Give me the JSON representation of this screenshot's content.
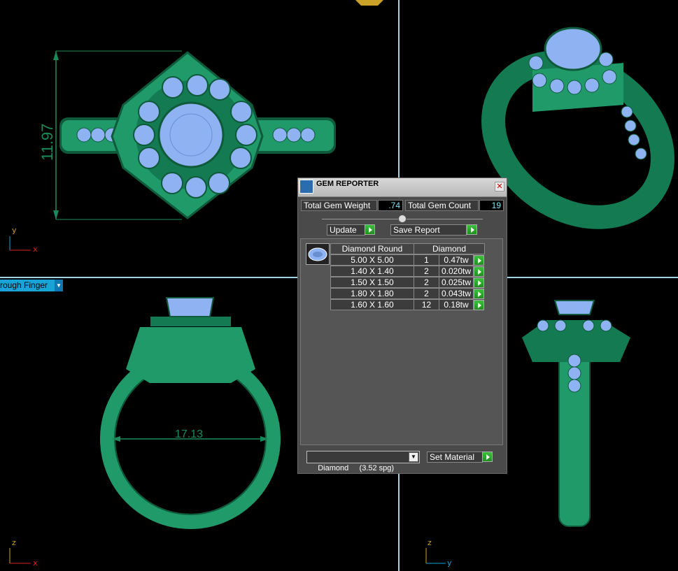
{
  "viewports": {
    "top_left": {
      "dimension": "11.97",
      "axis_v": "y",
      "axis_h": "x"
    },
    "top_right": {},
    "bottom_left": {
      "dimension": "17.13",
      "axis_v": "z",
      "axis_h": "x",
      "view_mode": "Through Finger",
      "view_mode_visible": "rough Finger"
    },
    "bottom_right": {
      "axis_v": "z",
      "axis_h": "y"
    }
  },
  "dialog": {
    "title": "GEM REPORTER",
    "close_icon": "close-icon",
    "total_weight_label": "Total Gem Weight",
    "total_weight_value": ".74",
    "total_count_label": "Total Gem Count",
    "total_count_value": "19",
    "update_label": "Update",
    "save_report_label": "Save Report",
    "table": {
      "header_shape": "Diamond Round",
      "header_material": "Diamond",
      "rows": [
        {
          "size": "5.00 X 5.00",
          "count": "1",
          "weight": "0.47tw"
        },
        {
          "size": "1.40 X 1.40",
          "count": "2",
          "weight": "0.020tw"
        },
        {
          "size": "1.50 X 1.50",
          "count": "2",
          "weight": "0.025tw"
        },
        {
          "size": "1.80 X 1.80",
          "count": "2",
          "weight": "0.043tw"
        },
        {
          "size": "1.60 X 1.60",
          "count": "12",
          "weight": "0.18tw"
        }
      ]
    },
    "material_value": "Diamond     (3.52 spg)",
    "set_material_label": "Set Material"
  },
  "colors": {
    "metal": "#1f9a68",
    "metal_dark": "#0e5a3a",
    "gem": "#8fb3f2",
    "grid": "#9fd3e0",
    "value_text": "#7de3f5"
  }
}
